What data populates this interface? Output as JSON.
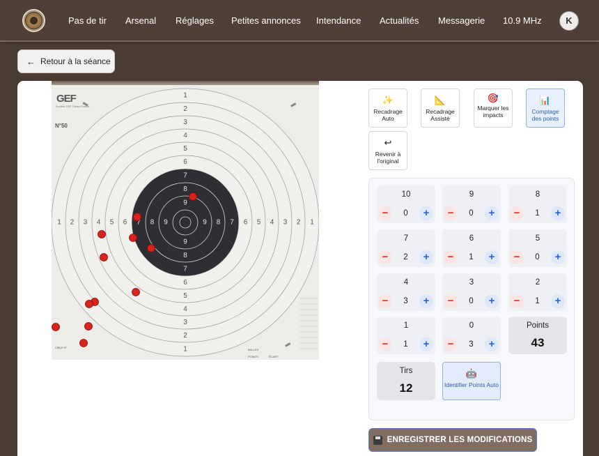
{
  "nav": {
    "items": [
      "Pas de tir",
      "Arsenal",
      "Réglages",
      "Petites annonces",
      "Intendance",
      "Actualités",
      "Messagerie",
      "10.9 MHz"
    ],
    "avatar_initial": "K"
  },
  "back_button": {
    "label": "Retour à la séance"
  },
  "target": {
    "brand": "GEF",
    "brand_small": "Société GEF Cibles France",
    "number": "N°50",
    "cible_label": "CIBLE N°",
    "balles_label": "BALLES",
    "points_label": "POINTS",
    "ecart_label": "ÉCART",
    "ring_numbers": [
      "1",
      "2",
      "3",
      "4",
      "5",
      "6",
      "7",
      "8",
      "9"
    ]
  },
  "tools": [
    {
      "label": "Recadrage Auto",
      "icon": "sparkles-icon",
      "active": false
    },
    {
      "label": "Recadrage Assisté",
      "icon": "set-square-icon",
      "active": false
    },
    {
      "label": "Marquer les impacts",
      "icon": "target-dart-icon",
      "active": false
    },
    {
      "label": "Comptage des points",
      "icon": "bar-chart-icon",
      "active": true
    },
    {
      "label": "Revenir à l'original",
      "icon": "undo-arrow-icon",
      "active": false
    }
  ],
  "scores": [
    {
      "label": "10",
      "count": "0"
    },
    {
      "label": "9",
      "count": "0"
    },
    {
      "label": "8",
      "count": "1"
    },
    {
      "label": "7",
      "count": "2"
    },
    {
      "label": "6",
      "count": "1"
    },
    {
      "label": "5",
      "count": "0"
    },
    {
      "label": "4",
      "count": "3"
    },
    {
      "label": "3",
      "count": "0"
    },
    {
      "label": "2",
      "count": "1"
    },
    {
      "label": "1",
      "count": "1"
    },
    {
      "label": "0",
      "count": "3"
    }
  ],
  "totals": {
    "points_label": "Points",
    "points_value": "43",
    "shots_label": "Tirs",
    "shots_value": "12"
  },
  "auto_identify": {
    "label": "Identifier Points Auto",
    "icon": "robot-icon"
  },
  "save_button": {
    "label": "ENREGISTRER LES MODIFICATIONS",
    "icon": "floppy-disk-icon"
  },
  "colors": {
    "background": "#4a3b33",
    "impact": "#d9231c",
    "accent": "#2a63d6"
  }
}
